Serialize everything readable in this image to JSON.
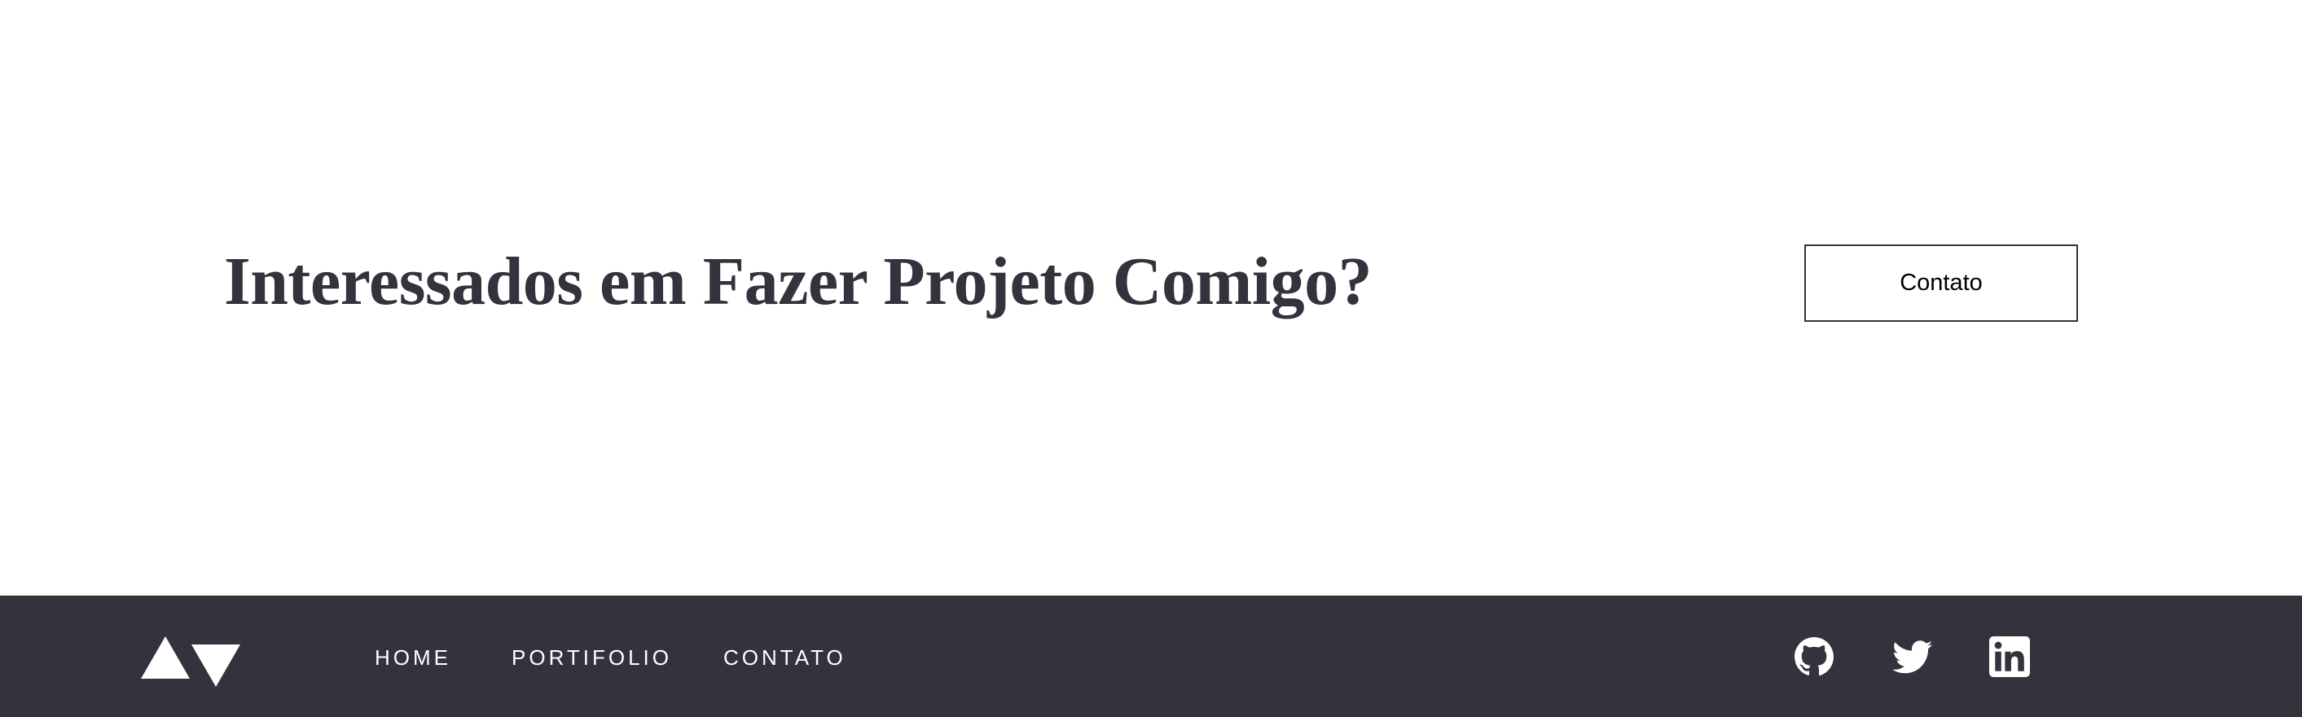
{
  "cta": {
    "heading": "Interessados em Fazer Projeto Comigo?",
    "button_label": "Contato"
  },
  "footer": {
    "logo": "logo-triangles",
    "nav": [
      {
        "label": "HOME"
      },
      {
        "label": "PORTIFOLIO"
      },
      {
        "label": "CONTATO"
      }
    ],
    "social": [
      {
        "icon": "github-icon"
      },
      {
        "icon": "twitter-icon"
      },
      {
        "icon": "linkedin-icon"
      }
    ]
  },
  "colors": {
    "dark": "#33323d",
    "background": "#ffffff",
    "footer_text": "#ffffff"
  }
}
